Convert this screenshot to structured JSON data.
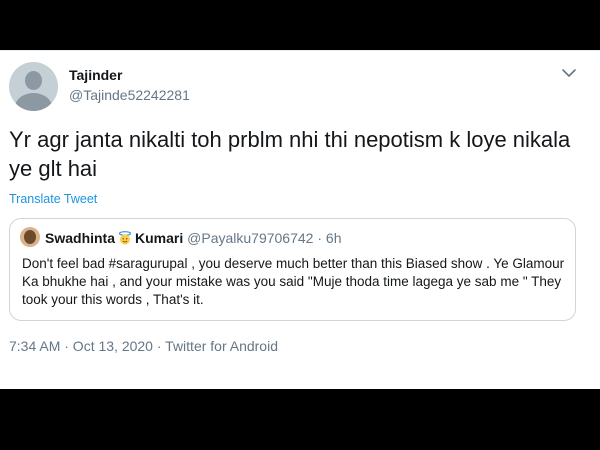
{
  "author": {
    "display_name": "Tajinder",
    "handle": "@Tajinde52242281"
  },
  "tweet": {
    "text": "Yr agr janta nikalti toh prblm nhi thi nepotism k loye nikala ye glt hai",
    "translate_label": "Translate Tweet"
  },
  "quoted": {
    "name_part1": "Swadhinta",
    "name_part2": "Kumari",
    "handle": "@Payalku79706742",
    "separator": "·",
    "time": "6h",
    "text": "Don't feel bad  #saragurupal , you deserve much better than this Biased show . Ye Glamour Ka bhukhe hai , and your mistake was you said \"Muje thoda time lagega ye sab me \" They took your this words , That's it."
  },
  "footer": {
    "timestamp": "7:34 AM · Oct 13, 2020 · Twitter for Android"
  },
  "icons": {
    "menu": "chevron-down-icon",
    "emoji": "smiling-face-with-halo-icon"
  },
  "colors": {
    "link": "#1b95e0",
    "secondary_text": "#657786",
    "primary_text": "#14171a",
    "border": "#ccd6dd"
  }
}
